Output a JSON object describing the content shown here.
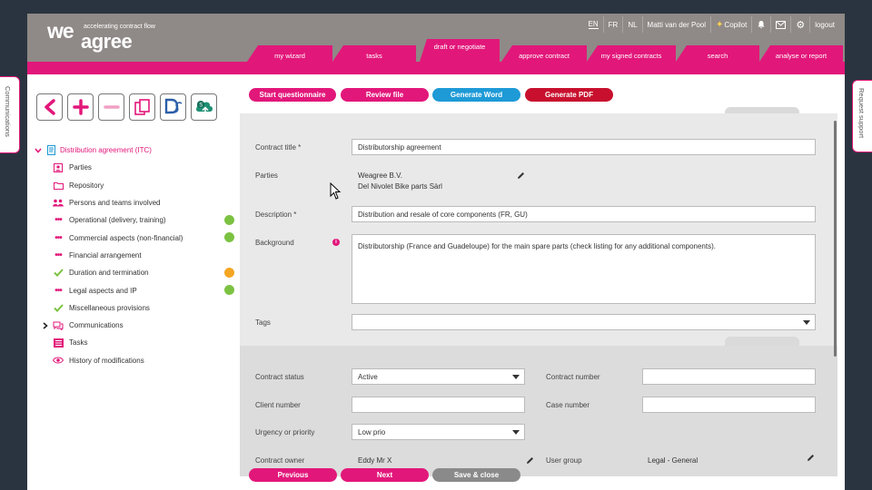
{
  "logo": {
    "we": "we",
    "agree": "agree",
    "tagline": "accelerating contract flow"
  },
  "topmenu": {
    "lang_en": "EN",
    "lang_fr": "FR",
    "lang_nl": "NL",
    "user": "Matti van der Pool",
    "copilot": "Copilot",
    "logout": "logout"
  },
  "tabs": [
    "my wizard",
    "tasks",
    "draft or negotiate",
    "approve contract",
    "my signed contracts",
    "search",
    "analyse or report"
  ],
  "side": {
    "left": "Communications",
    "right": "Request support"
  },
  "tree": {
    "root": "Distribution agreement (ITC)",
    "items": [
      "Parties",
      "Repository",
      "Persons and teams involved",
      "Operational (delivery, training)",
      "Commercial aspects (non-financial)",
      "Financial arrangement",
      "Duration and termination",
      "Legal aspects and IP",
      "Miscellaneous provisions",
      "Communications",
      "Tasks",
      "History of modifications"
    ]
  },
  "actions": {
    "start": "Start questionnaire",
    "review": "Review file",
    "word": "Generate Word",
    "pdf": "Generate PDF"
  },
  "form": {
    "contract_title_label": "Contract title *",
    "contract_title": "Distributorship agreement",
    "parties_label": "Parties",
    "party1": "Weagree B.V.",
    "party2": "Del Nivolet Bike parts Sàrl",
    "description_label": "Description *",
    "description": "Distribution and resale of core components (FR, GU)",
    "background_label": "Background",
    "background": "Distributorship (France and Guadeloupe) for the main spare parts (check listing for any additional components).",
    "tags_label": "Tags",
    "tags": "",
    "status_label": "Contract status",
    "status": "Active",
    "contract_number_label": "Contract number",
    "contract_number": "",
    "client_number_label": "Client number",
    "client_number": "",
    "case_number_label": "Case number",
    "case_number": "",
    "urgency_label": "Urgency or priority",
    "urgency": "Low prio",
    "owner_label": "Contract owner",
    "owner": "Eddy Mr X",
    "group_label": "User group",
    "group": "Legal - General"
  },
  "nav": {
    "previous": "Previous",
    "next": "Next",
    "save": "Save & close"
  },
  "colors": {
    "brand": "#e2177a",
    "header": "#8f8987",
    "word": "#1e9ad6",
    "pdf": "#c8102e",
    "green": "#7cc242",
    "orange": "#f5a623"
  }
}
